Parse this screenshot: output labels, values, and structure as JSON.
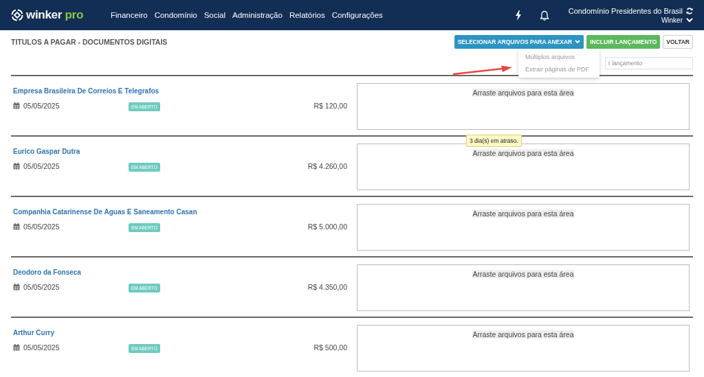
{
  "navbar": {
    "logo": {
      "word": "winker",
      "suffix": "pro"
    },
    "menu": [
      "Financeiro",
      "Condomínio",
      "Social",
      "Administração",
      "Relatórios",
      "Configurações"
    ],
    "account": {
      "condominium": "Condomínio Presidentes do Brasil",
      "user": "Winker"
    }
  },
  "page": {
    "title": "TITULOS A PAGAR - DOCUMENTOS DIGITAIS",
    "buttons": [
      {
        "label": "SELECIONAR ARQUIVOS PARA ANEXAR",
        "kind": "dropdown"
      },
      {
        "label": "INCLUIR LANÇAMENTO",
        "kind": "success"
      },
      {
        "label": "VOLTAR",
        "kind": "plain"
      }
    ],
    "dropdown_menu": [
      "Múltiplos arquivos",
      "Extrair páginas de PDF"
    ],
    "search": {
      "placeholder": "r lançamento"
    }
  },
  "bills": [
    {
      "payee": "Empresa Brasileira De Correios E Telegrafos",
      "date": "05/05/2025",
      "status": "EM ABERTO",
      "amount": "R$ 120,00",
      "drop_zone": "Arraste arquivos para esta área"
    },
    {
      "payee": "Eurico Gaspar Dutra",
      "date": "05/05/2025",
      "status": "EM ABERTO",
      "amount": "R$ 4.260,00",
      "drop_zone": "Arraste arquivos para esta área",
      "tooltip": "3 dia(s) em atraso."
    },
    {
      "payee": "Companhia Catarinense De Aguas E Saneamento Casan",
      "date": "05/05/2025",
      "status": "EM ABERTO",
      "amount": "R$ 5.000,00",
      "drop_zone": "Arraste arquivos para esta área"
    },
    {
      "payee": "Deodoro da Fonseca",
      "date": "05/05/2025",
      "status": "EM ABERTO",
      "amount": "R$ 4.350,00",
      "drop_zone": "Arraste arquivos para esta área"
    },
    {
      "payee": "Arthur Curry",
      "date": "05/05/2025",
      "status": "EM ABERTO",
      "amount": "R$ 500,00",
      "drop_zone": "Arraste arquivos para esta área"
    }
  ]
}
